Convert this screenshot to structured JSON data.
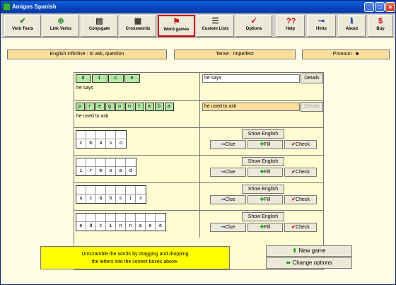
{
  "window": {
    "title": "Amigos Spanish",
    "min": "_",
    "max": "□",
    "close": "×"
  },
  "toolbar": [
    {
      "label": "Verb Tests",
      "icon": "check-icon",
      "glyph": "✔"
    },
    {
      "label": "Link Verbs",
      "icon": "link-icon",
      "glyph": "⊕"
    },
    {
      "label": "Conjugate",
      "icon": "conjugate-icon",
      "glyph": "▤"
    },
    {
      "label": "Crosswords",
      "icon": "crossword-icon",
      "glyph": "▦"
    },
    {
      "label": "Word games",
      "icon": "wordgame-icon",
      "glyph": "⚑"
    },
    {
      "label": "Custom Lists",
      "icon": "list-icon",
      "glyph": "☰"
    },
    {
      "label": "Options",
      "icon": "options-icon",
      "glyph": "✓"
    },
    {
      "label": "Help",
      "icon": "help-icon",
      "glyph": "??"
    },
    {
      "label": "Hints",
      "icon": "hints-icon",
      "glyph": "⊸"
    },
    {
      "label": "About",
      "icon": "about-icon",
      "glyph": "ℹ"
    },
    {
      "label": "Buy",
      "icon": "buy-icon",
      "glyph": "$"
    }
  ],
  "info": {
    "infinitive": "English infinitive : to ask, question",
    "tense": "Tense : Imperfect",
    "pronoun": "Pronoun : ■"
  },
  "clues": [
    {
      "letters": [
        "d",
        "i",
        "c",
        "e"
      ],
      "meaning": "he says",
      "response": "he says",
      "details": "Details",
      "highlight": false,
      "enabled": true
    },
    {
      "letters": [
        "p",
        "r",
        "e",
        "g",
        "u",
        "n",
        "t",
        "a",
        "b",
        "a"
      ],
      "meaning": "he used to ask",
      "response": "he used to ask",
      "details": "Details",
      "highlight": true,
      "enabled": false
    }
  ],
  "scrambles": [
    {
      "letters": [
        "c",
        "m",
        "a",
        "s",
        "o"
      ]
    },
    {
      "letters": [
        "i",
        "r",
        "m",
        "o",
        "a",
        "d"
      ]
    },
    {
      "letters": [
        "u",
        "c",
        "á",
        "b",
        "s",
        "i",
        "s"
      ]
    },
    {
      "letters": [
        "e",
        "d",
        "t",
        "i",
        "n",
        "n",
        "a",
        "e",
        "e"
      ]
    }
  ],
  "buttons": {
    "show_english": "Show English",
    "clue": "Clue",
    "fill": "Fill",
    "check": "Check"
  },
  "hint": {
    "line1": "Unscramble the words by dragging and dropping",
    "line2": "the letters into the correct boxes above."
  },
  "actions": {
    "new_game": "New game",
    "change_options": "Change options"
  },
  "colors": {
    "green_letters": "#b3e8a4",
    "info_bg": "#fcdf9c",
    "hint_bg": "#ffff00"
  }
}
